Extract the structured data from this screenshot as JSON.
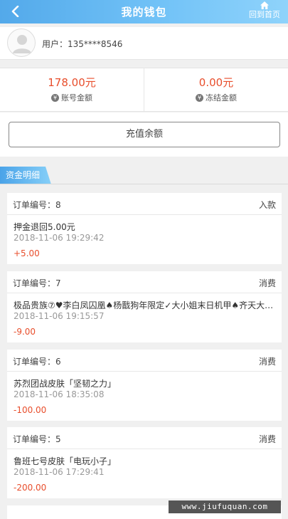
{
  "header": {
    "title": "我的钱包",
    "home_label": "回到首页"
  },
  "user": {
    "label": "用户：135****8546"
  },
  "balances": [
    {
      "amount": "178.00元",
      "caption": "账号金额",
      "icon": "yen-coin-icon"
    },
    {
      "amount": "0.00元",
      "caption": "冻结金额",
      "icon": "yen-coin-icon"
    }
  ],
  "recharge": {
    "label": "充值余额"
  },
  "section": {
    "title": "资金明细"
  },
  "orders": [
    {
      "no": "订单编号：8",
      "type": "入款",
      "desc": "押金退回5.00元",
      "time": "2018-11-06 19:29:42",
      "amount": "+5.00"
    },
    {
      "no": "订单编号：7",
      "type": "消费",
      "desc": "极品贵族⑦♥李白凤囚凰♠杨戬狗年限定✓大小姐末日机甲♠齐天大圣...",
      "time": "2018-11-06 19:15:57",
      "amount": "-9.00"
    },
    {
      "no": "订单编号：6",
      "type": "消费",
      "desc": "苏烈团战皮肤「坚韧之力」",
      "time": "2018-11-06 18:35:08",
      "amount": "-100.00"
    },
    {
      "no": "订单编号：5",
      "type": "消费",
      "desc": "鲁班七号皮肤「电玩小子」",
      "time": "2018-11-06 17:29:41",
      "amount": "-200.00"
    }
  ],
  "watermark": "www.jiufuquan.com",
  "colors": {
    "header_start": "#53a9ea",
    "header_end": "#8fd3fb",
    "amount_red": "#e84e2c"
  }
}
